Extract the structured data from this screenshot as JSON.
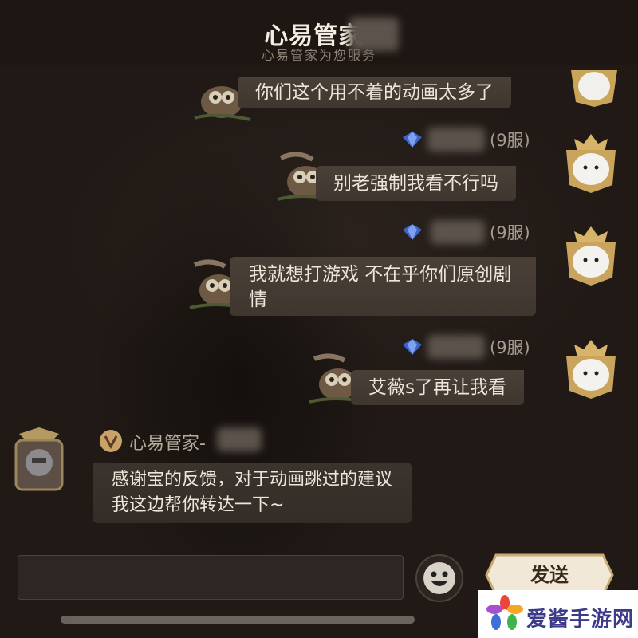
{
  "header": {
    "title": "心易管家-",
    "subtitle": "心易管家为您服务"
  },
  "messages": [
    {
      "text": "你们这个用不着的动画太多了",
      "server": ""
    },
    {
      "text": "别老强制我看不行吗",
      "server": "(9服)"
    },
    {
      "text": "我就想打游戏 不在乎你们原创剧情",
      "server": "(9服)"
    },
    {
      "text": "艾薇s了再让我看",
      "server": "(9服)"
    }
  ],
  "assistant": {
    "name": "心易管家-",
    "text": "感谢宝的反馈，对于动画跳过的建议我这边帮你转达一下~"
  },
  "input": {
    "send_label": "发送"
  },
  "watermark": {
    "text": "爱酱手游网"
  },
  "icons": [
    "owl-sticker-icon",
    "diamond-icon",
    "emoji-icon",
    "butler-badge-icon",
    "watermark-logo-icon"
  ],
  "colors": {
    "background": "#221a16",
    "bubble": "#453b34",
    "text": "#ede6da",
    "muted": "#a59a8e",
    "gem": "#3f64c8",
    "send_button": "#f1e8d8"
  }
}
